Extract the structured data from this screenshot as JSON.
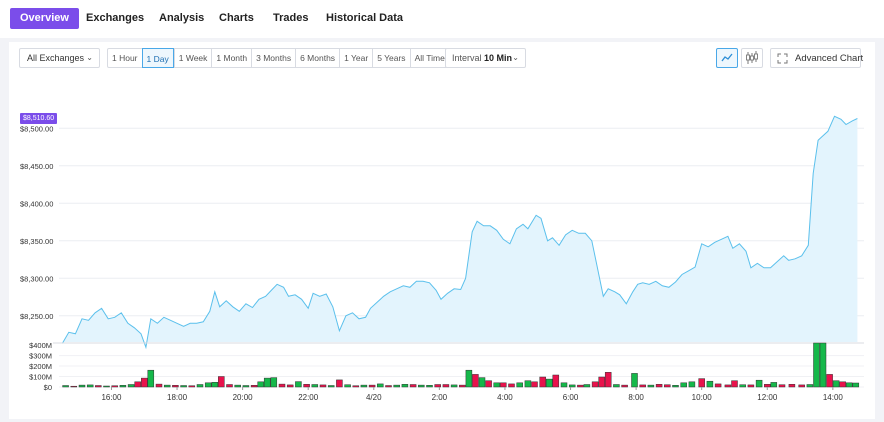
{
  "nav": {
    "tabs": [
      "Overview",
      "Exchanges",
      "Analysis",
      "Charts",
      "Trades",
      "Historical Data"
    ],
    "active": 0
  },
  "controls": {
    "exchange_select": "All Exchanges",
    "ranges": [
      "1 Hour",
      "1 Day",
      "1 Week",
      "1 Month",
      "3 Months",
      "6 Months",
      "1 Year",
      "5 Years",
      "All Time"
    ],
    "selected_range": 1,
    "interval_label": "Interval",
    "interval_value": "10 Min",
    "advanced_chart": "Advanced Chart"
  },
  "colors": {
    "accent": "#7b4dea",
    "line": "#5bc0ec",
    "fill": "#e3f4fd",
    "vol_up": "#15b84a",
    "vol_down": "#e8124c"
  },
  "icons": {
    "line_chart": "line-chart-icon",
    "candle_chart": "candlestick-icon",
    "expand": "expand-icon"
  },
  "chart_data": [
    {
      "type": "area",
      "current_price_label": "$8,510.60",
      "y_ticks": [
        "$8,500.00",
        "$8,450.00",
        "$8,400.00",
        "$8,350.00",
        "$8,300.00",
        "$8,250.00"
      ],
      "y_tick_values": [
        8500,
        8450,
        8400,
        8350,
        8300,
        8250
      ],
      "ylim": [
        8215,
        8535
      ],
      "x_ticks": [
        "16:00",
        "18:00",
        "20:00",
        "22:00",
        "4/20",
        "2:00",
        "4:00",
        "6:00",
        "8:00",
        "10:00",
        "12:00",
        "14:00"
      ],
      "x_tick_hours": [
        16,
        18,
        20,
        22,
        24,
        26,
        28,
        30,
        32,
        34,
        36,
        38
      ],
      "grid": true,
      "series": [
        {
          "points": [
            [
              14.5,
              8213
            ],
            [
              14.7,
              8228
            ],
            [
              14.9,
              8226
            ],
            [
              15.1,
              8246
            ],
            [
              15.3,
              8244
            ],
            [
              15.5,
              8254
            ],
            [
              15.7,
              8260
            ],
            [
              15.9,
              8246
            ],
            [
              16.1,
              8248
            ],
            [
              16.3,
              8254
            ],
            [
              16.5,
              8240
            ],
            [
              16.7,
              8234
            ],
            [
              16.9,
              8226
            ],
            [
              17.05,
              8208
            ],
            [
              17.2,
              8246
            ],
            [
              17.4,
              8240
            ],
            [
              17.6,
              8248
            ],
            [
              17.8,
              8244
            ],
            [
              18.0,
              8240
            ],
            [
              18.2,
              8236
            ],
            [
              18.4,
              8240
            ],
            [
              18.6,
              8240
            ],
            [
              18.8,
              8242
            ],
            [
              19.0,
              8256
            ],
            [
              19.15,
              8282
            ],
            [
              19.3,
              8262
            ],
            [
              19.5,
              8270
            ],
            [
              19.7,
              8262
            ],
            [
              19.9,
              8256
            ],
            [
              20.1,
              8266
            ],
            [
              20.3,
              8261
            ],
            [
              20.5,
              8272
            ],
            [
              20.7,
              8276
            ],
            [
              20.9,
              8285
            ],
            [
              21.05,
              8292
            ],
            [
              21.25,
              8288
            ],
            [
              21.4,
              8276
            ],
            [
              21.6,
              8278
            ],
            [
              21.8,
              8272
            ],
            [
              22.0,
              8260
            ],
            [
              22.15,
              8280
            ],
            [
              22.35,
              8276
            ],
            [
              22.55,
              8279
            ],
            [
              22.75,
              8262
            ],
            [
              22.95,
              8230
            ],
            [
              23.15,
              8250
            ],
            [
              23.35,
              8254
            ],
            [
              23.55,
              8246
            ],
            [
              23.75,
              8248
            ],
            [
              23.9,
              8260
            ],
            [
              24.1,
              8268
            ],
            [
              24.3,
              8276
            ],
            [
              24.5,
              8282
            ],
            [
              24.7,
              8286
            ],
            [
              24.9,
              8290
            ],
            [
              25.1,
              8288
            ],
            [
              25.3,
              8296
            ],
            [
              25.5,
              8296
            ],
            [
              25.7,
              8294
            ],
            [
              25.9,
              8284
            ],
            [
              26.05,
              8272
            ],
            [
              26.25,
              8280
            ],
            [
              26.45,
              8286
            ],
            [
              26.65,
              8285
            ],
            [
              26.8,
              8300
            ],
            [
              27.0,
              8362
            ],
            [
              27.15,
              8376
            ],
            [
              27.35,
              8370
            ],
            [
              27.55,
              8370
            ],
            [
              27.75,
              8364
            ],
            [
              27.95,
              8352
            ],
            [
              28.15,
              8346
            ],
            [
              28.35,
              8366
            ],
            [
              28.55,
              8372
            ],
            [
              28.7,
              8366
            ],
            [
              28.95,
              8384
            ],
            [
              29.1,
              8380
            ],
            [
              29.3,
              8350
            ],
            [
              29.45,
              8354
            ],
            [
              29.65,
              8344
            ],
            [
              29.85,
              8358
            ],
            [
              30.05,
              8364
            ],
            [
              30.25,
              8360
            ],
            [
              30.45,
              8360
            ],
            [
              30.65,
              8350
            ],
            [
              30.8,
              8318
            ],
            [
              31.0,
              8276
            ],
            [
              31.15,
              8286
            ],
            [
              31.35,
              8282
            ],
            [
              31.5,
              8278
            ],
            [
              31.7,
              8266
            ],
            [
              31.9,
              8282
            ],
            [
              32.05,
              8292
            ],
            [
              32.2,
              8294
            ],
            [
              32.4,
              8292
            ],
            [
              32.6,
              8296
            ],
            [
              32.8,
              8290
            ],
            [
              33.0,
              8288
            ],
            [
              33.2,
              8295
            ],
            [
              33.4,
              8305
            ],
            [
              33.6,
              8310
            ],
            [
              33.8,
              8315
            ],
            [
              34.0,
              8346
            ],
            [
              34.2,
              8342
            ],
            [
              34.4,
              8348
            ],
            [
              34.6,
              8352
            ],
            [
              34.8,
              8356
            ],
            [
              34.95,
              8340
            ],
            [
              35.15,
              8346
            ],
            [
              35.35,
              8336
            ],
            [
              35.5,
              8314
            ],
            [
              35.7,
              8320
            ],
            [
              35.9,
              8314
            ],
            [
              36.1,
              8314
            ],
            [
              36.3,
              8322
            ],
            [
              36.5,
              8330
            ],
            [
              36.65,
              8324
            ],
            [
              36.85,
              8326
            ],
            [
              37.05,
              8330
            ],
            [
              37.25,
              8344
            ],
            [
              37.4,
              8440
            ],
            [
              37.55,
              8484
            ],
            [
              37.7,
              8490
            ],
            [
              37.85,
              8496
            ],
            [
              38.05,
              8516
            ],
            [
              38.25,
              8512
            ],
            [
              38.4,
              8505
            ],
            [
              38.6,
              8510
            ],
            [
              38.75,
              8513
            ]
          ]
        }
      ]
    },
    {
      "type": "bar",
      "y_ticks": [
        "$400M",
        "$300M",
        "$200M",
        "$100M",
        "$0"
      ],
      "y_tick_values": [
        400,
        300,
        200,
        100,
        0
      ],
      "ylim": [
        0,
        420
      ],
      "series": [
        {
          "name": "volume",
          "bars": [
            [
              14.6,
              14,
              "g"
            ],
            [
              14.85,
              8,
              "r"
            ],
            [
              15.1,
              18,
              "g"
            ],
            [
              15.35,
              20,
              "g"
            ],
            [
              15.6,
              14,
              "r"
            ],
            [
              15.85,
              10,
              "g"
            ],
            [
              16.1,
              12,
              "r"
            ],
            [
              16.35,
              16,
              "g"
            ],
            [
              16.6,
              24,
              "g"
            ],
            [
              16.8,
              50,
              "r"
            ],
            [
              17.0,
              85,
              "r"
            ],
            [
              17.2,
              160,
              "g"
            ],
            [
              17.45,
              28,
              "r"
            ],
            [
              17.7,
              18,
              "g"
            ],
            [
              17.95,
              16,
              "r"
            ],
            [
              18.2,
              14,
              "g"
            ],
            [
              18.45,
              12,
              "r"
            ],
            [
              18.7,
              24,
              "g"
            ],
            [
              18.95,
              40,
              "g"
            ],
            [
              19.15,
              45,
              "g"
            ],
            [
              19.35,
              100,
              "r"
            ],
            [
              19.6,
              24,
              "r"
            ],
            [
              19.85,
              18,
              "g"
            ],
            [
              20.1,
              14,
              "g"
            ],
            [
              20.35,
              16,
              "r"
            ],
            [
              20.55,
              50,
              "g"
            ],
            [
              20.75,
              85,
              "g"
            ],
            [
              20.95,
              90,
              "g"
            ],
            [
              21.2,
              28,
              "r"
            ],
            [
              21.45,
              20,
              "r"
            ],
            [
              21.7,
              52,
              "g"
            ],
            [
              21.95,
              26,
              "r"
            ],
            [
              22.2,
              24,
              "g"
            ],
            [
              22.45,
              20,
              "r"
            ],
            [
              22.7,
              14,
              "g"
            ],
            [
              22.95,
              68,
              "r"
            ],
            [
              23.2,
              22,
              "g"
            ],
            [
              23.45,
              12,
              "r"
            ],
            [
              23.7,
              18,
              "g"
            ],
            [
              23.95,
              18,
              "r"
            ],
            [
              24.2,
              30,
              "g"
            ],
            [
              24.45,
              14,
              "r"
            ],
            [
              24.7,
              18,
              "g"
            ],
            [
              24.95,
              26,
              "g"
            ],
            [
              25.2,
              24,
              "r"
            ],
            [
              25.45,
              18,
              "g"
            ],
            [
              25.7,
              16,
              "g"
            ],
            [
              25.95,
              24,
              "r"
            ],
            [
              26.2,
              24,
              "r"
            ],
            [
              26.45,
              20,
              "g"
            ],
            [
              26.7,
              18,
              "r"
            ],
            [
              26.9,
              160,
              "g"
            ],
            [
              27.1,
              120,
              "r"
            ],
            [
              27.3,
              90,
              "g"
            ],
            [
              27.5,
              60,
              "r"
            ],
            [
              27.75,
              40,
              "g"
            ],
            [
              27.95,
              40,
              "r"
            ],
            [
              28.2,
              30,
              "r"
            ],
            [
              28.45,
              40,
              "g"
            ],
            [
              28.7,
              60,
              "g"
            ],
            [
              28.9,
              50,
              "r"
            ],
            [
              29.15,
              95,
              "r"
            ],
            [
              29.35,
              75,
              "g"
            ],
            [
              29.55,
              115,
              "r"
            ],
            [
              29.8,
              40,
              "g"
            ],
            [
              30.05,
              20,
              "g"
            ],
            [
              30.3,
              18,
              "r"
            ],
            [
              30.5,
              24,
              "g"
            ],
            [
              30.75,
              50,
              "r"
            ],
            [
              30.95,
              95,
              "r"
            ],
            [
              31.15,
              140,
              "r"
            ],
            [
              31.4,
              24,
              "g"
            ],
            [
              31.65,
              18,
              "r"
            ],
            [
              31.95,
              130,
              "g"
            ],
            [
              32.2,
              20,
              "r"
            ],
            [
              32.45,
              18,
              "g"
            ],
            [
              32.7,
              26,
              "r"
            ],
            [
              32.95,
              22,
              "r"
            ],
            [
              33.2,
              16,
              "g"
            ],
            [
              33.45,
              40,
              "g"
            ],
            [
              33.7,
              50,
              "g"
            ],
            [
              34.0,
              80,
              "r"
            ],
            [
              34.25,
              55,
              "g"
            ],
            [
              34.5,
              30,
              "r"
            ],
            [
              34.8,
              20,
              "r"
            ],
            [
              35.0,
              60,
              "r"
            ],
            [
              35.25,
              22,
              "g"
            ],
            [
              35.5,
              20,
              "r"
            ],
            [
              35.75,
              65,
              "g"
            ],
            [
              36.0,
              26,
              "r"
            ],
            [
              36.2,
              44,
              "g"
            ],
            [
              36.45,
              22,
              "r"
            ],
            [
              36.75,
              26,
              "r"
            ],
            [
              37.05,
              20,
              "r"
            ],
            [
              37.3,
              24,
              "g"
            ],
            [
              37.5,
              445,
              "g"
            ],
            [
              37.7,
              445,
              "g"
            ],
            [
              37.9,
              120,
              "r"
            ],
            [
              38.1,
              60,
              "g"
            ],
            [
              38.3,
              50,
              "r"
            ],
            [
              38.5,
              40,
              "g"
            ],
            [
              38.7,
              38,
              "g"
            ]
          ]
        }
      ]
    }
  ]
}
